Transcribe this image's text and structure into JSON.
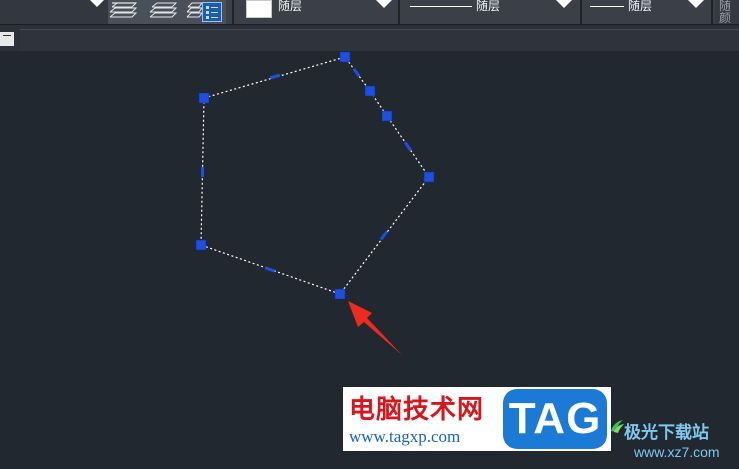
{
  "toolbar": {
    "color_combo": {
      "label": "随层"
    },
    "linetype_combo": {
      "label": "随层"
    },
    "lineweight_combo": {
      "label": "随层"
    },
    "plotstyle_combo": {
      "label": "随颜"
    }
  },
  "canvas": {
    "polygon": {
      "stroke": "#ffffff",
      "grip_color": "#1f4fe0",
      "vertex_grips": 5,
      "midpoint_grips": 5
    },
    "arrow_color": "#f02a1e"
  },
  "watermark": {
    "site_title": "电脑技术网",
    "site_url": "www.tagxp.com",
    "tag_logo": "TAG",
    "jg_title": "极光下载站",
    "jg_url": "www.xz7.com"
  }
}
